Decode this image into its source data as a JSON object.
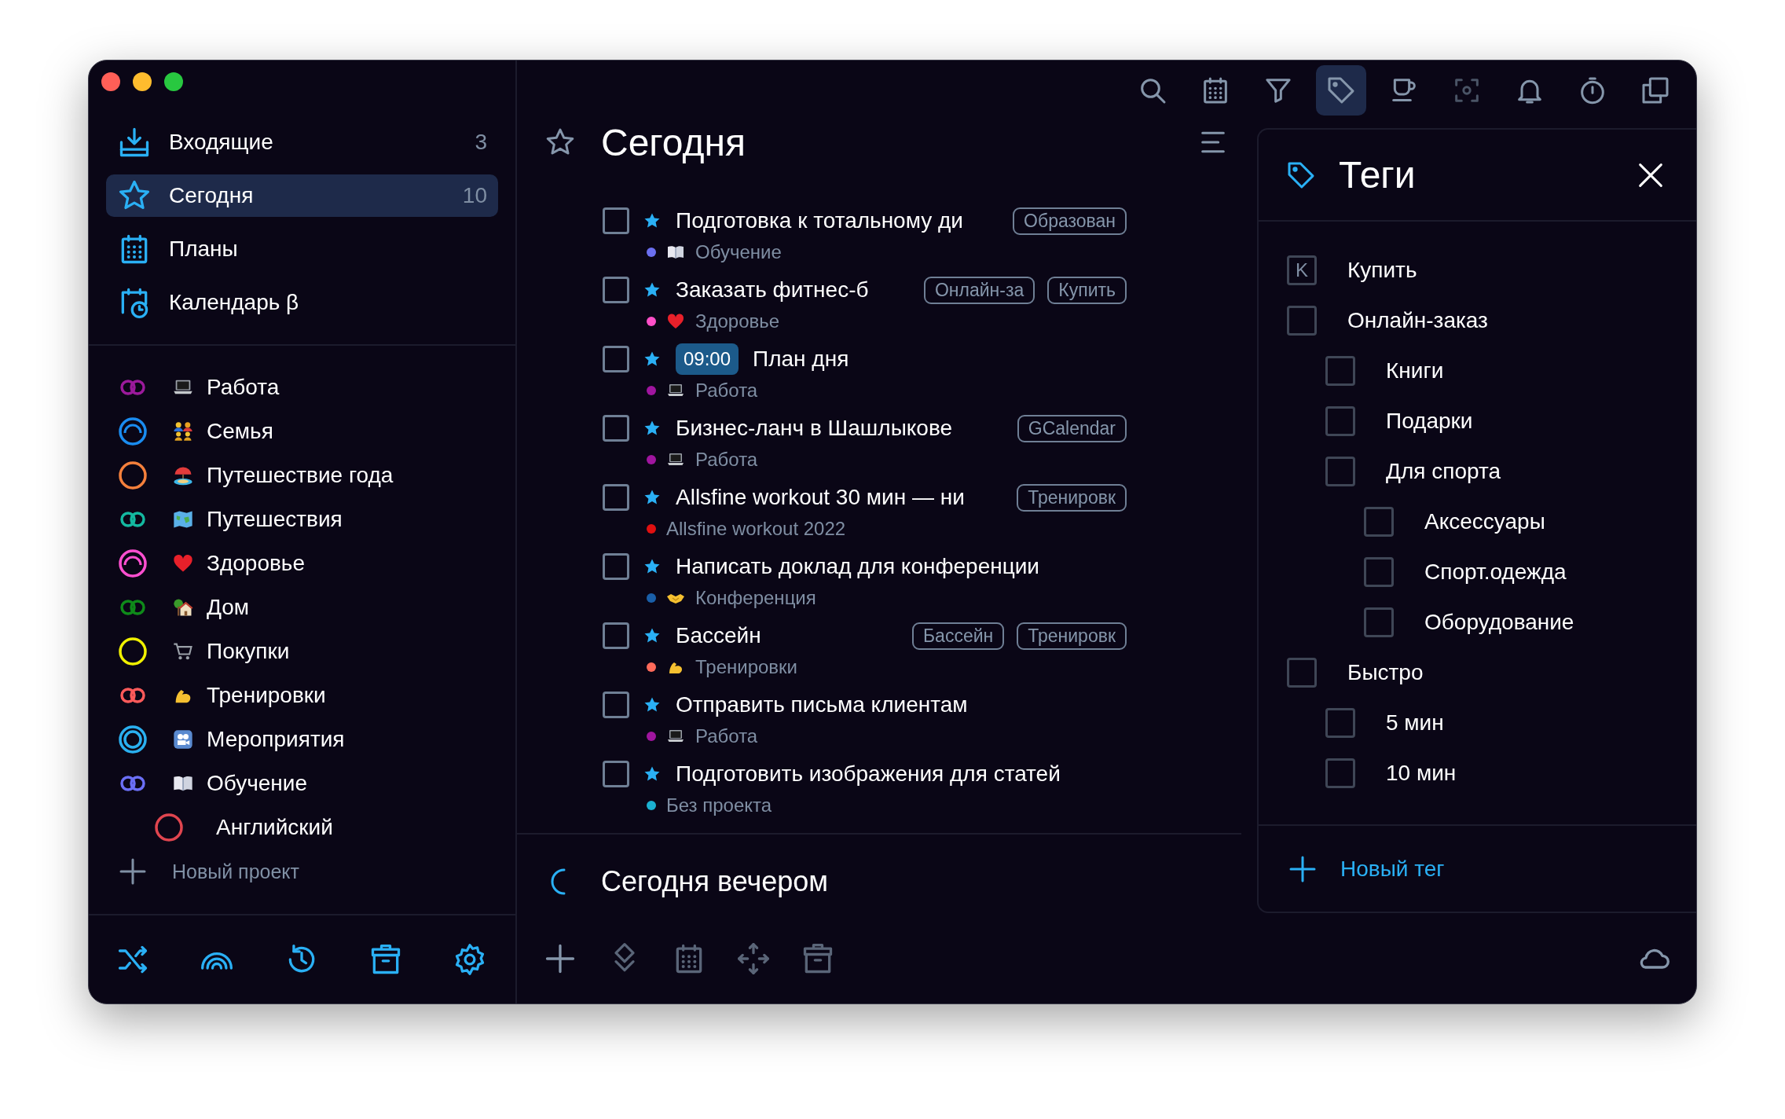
{
  "sidebar": {
    "nav": [
      {
        "kind": "inbox",
        "label": "Входящие",
        "count": "3",
        "selected": false
      },
      {
        "kind": "star",
        "label": "Сегодня",
        "count": "10",
        "selected": true
      },
      {
        "kind": "calendar",
        "label": "Планы",
        "selected": false
      },
      {
        "kind": "calendar-clock",
        "label": "Календарь β",
        "selected": false
      }
    ],
    "projects": [
      {
        "kind": "laptop",
        "color": "#9b1a9b",
        "name": "Работа"
      },
      {
        "kind": "family",
        "color": "#1a8cf0",
        "name": "Семья"
      },
      {
        "kind": "beach",
        "color": "#f5803c",
        "name": "Путешествие года"
      },
      {
        "kind": "map",
        "color": "#14b8a0",
        "name": "Путешествия"
      },
      {
        "kind": "heart",
        "color": "#ff4fd0",
        "name": "Здоровье"
      },
      {
        "kind": "house",
        "color": "#0f8a1a",
        "name": "Дом"
      },
      {
        "kind": "cart",
        "color": "#f0f000",
        "name": "Покупки"
      },
      {
        "kind": "muscle",
        "color": "#ff5a5a",
        "name": "Тренировки"
      },
      {
        "kind": "camera",
        "color": "#2ab0f0",
        "name": "Мероприятия"
      },
      {
        "kind": "book",
        "color": "#6b6ff5",
        "name": "Обучение",
        "children": [
          {
            "color": "#e0454f",
            "name": "Английский"
          }
        ]
      }
    ],
    "new_project": "Новый проект"
  },
  "toolbar": [
    {
      "selected": false,
      "disabled": false
    },
    {
      "selected": false,
      "disabled": false
    },
    {
      "selected": false,
      "disabled": false
    },
    {
      "selected": true,
      "disabled": false
    },
    {
      "selected": false,
      "disabled": false
    },
    {
      "selected": false,
      "disabled": true
    },
    {
      "selected": false,
      "disabled": false
    },
    {
      "selected": false,
      "disabled": false
    },
    {
      "selected": false,
      "disabled": false
    }
  ],
  "today": {
    "title": "Сегодня",
    "tasks": [
      {
        "checked": false,
        "starred": true,
        "title": "Подготовка к тотальному ди",
        "tags": [
          "Образован"
        ],
        "project": {
          "color": "#6b6ff0",
          "kind": "book",
          "name": "Обучение"
        }
      },
      {
        "checked": false,
        "starred": true,
        "title": "Заказать фитнес-б",
        "tags": [
          "Онлайн-за",
          "Купить"
        ],
        "project": {
          "color": "#ff4fc8",
          "kind": "heart",
          "name": "Здоровье"
        }
      },
      {
        "checked": false,
        "starred": true,
        "time": "09:00",
        "title": "План дня",
        "project": {
          "color": "#a0159f",
          "kind": "laptop",
          "name": "Работа"
        }
      },
      {
        "checked": false,
        "starred": true,
        "title": "Бизнес-ланч в Шашлыкове",
        "tags": [
          "GCalendar"
        ],
        "project": {
          "color": "#a0159f",
          "kind": "laptop",
          "name": "Работа"
        }
      },
      {
        "checked": false,
        "starred": true,
        "title": "Allsfine workout 30 мин — ни",
        "tags": [
          "Тренировк"
        ],
        "project": {
          "color": "#e01010",
          "name": "Allsfine workout 2022"
        }
      },
      {
        "checked": false,
        "starred": true,
        "title": "Написать доклад для конференции",
        "project": {
          "color": "#1a5fa8",
          "kind": "handshake",
          "name": "Конференция"
        }
      },
      {
        "checked": false,
        "starred": true,
        "title": "Бассейн",
        "tags": [
          "Бассейн",
          "Тренировк"
        ],
        "project": {
          "color": "#ff6a5a",
          "kind": "muscle",
          "name": "Тренировки"
        }
      },
      {
        "checked": false,
        "starred": true,
        "title": "Отправить письма клиентам",
        "project": {
          "color": "#a0159f",
          "kind": "laptop",
          "name": "Работа"
        }
      },
      {
        "checked": false,
        "starred": true,
        "title": "Подготовить изображения для статей",
        "project": {
          "color": "#1bb0d0",
          "name": "Без проекта"
        }
      }
    ],
    "evening": "Сегодня вечером"
  },
  "tags_panel": {
    "title": "Теги",
    "tags": [
      {
        "label": "Купить",
        "key": "K"
      },
      {
        "label": "Онлайн-заказ",
        "checked": false,
        "children": [
          {
            "label": "Книги",
            "checked": false
          },
          {
            "label": "Подарки",
            "checked": false
          },
          {
            "label": "Для спорта",
            "checked": false,
            "children": [
              {
                "label": "Аксессуары",
                "checked": false
              },
              {
                "label": "Спорт.одежда",
                "checked": false
              },
              {
                "label": "Оборудование",
                "checked": false
              }
            ]
          }
        ]
      },
      {
        "label": "Быстро",
        "checked": false,
        "children": [
          {
            "label": "5 мин",
            "checked": false
          },
          {
            "label": "10 мин",
            "checked": false
          }
        ]
      }
    ],
    "new_tag": "Новый тег"
  }
}
